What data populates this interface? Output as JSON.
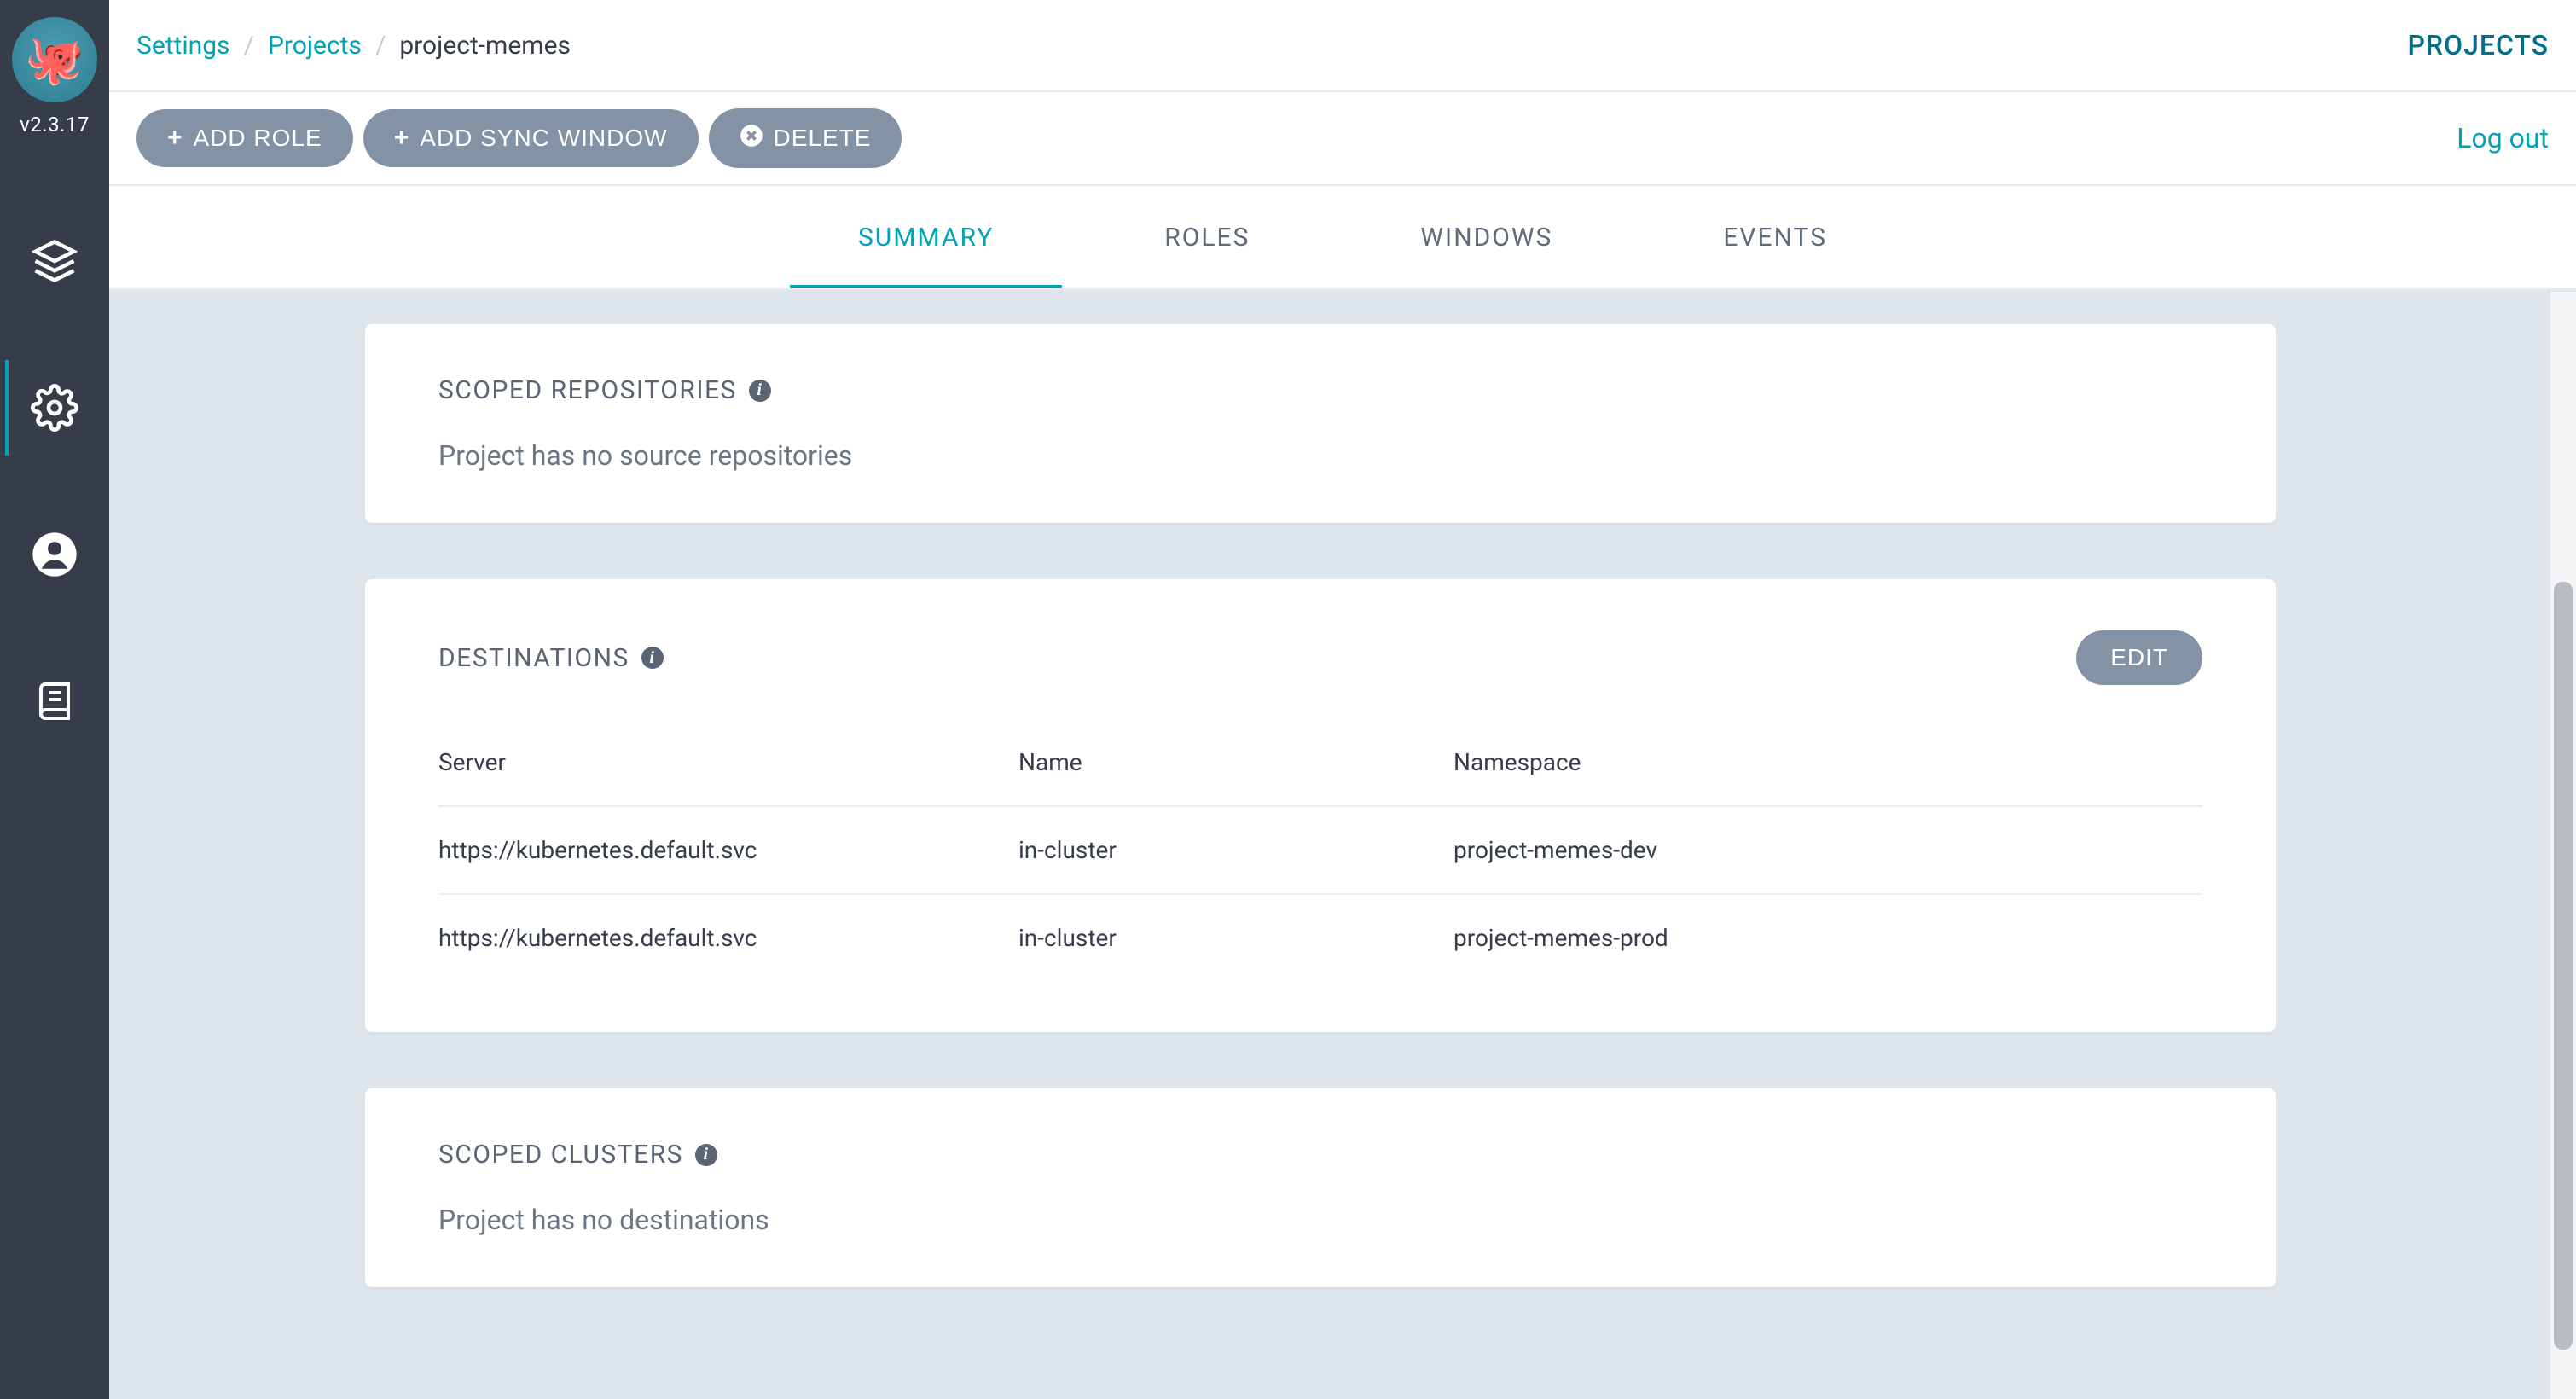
{
  "sidebar": {
    "version": "v2.3.17"
  },
  "breadcrumbs": {
    "settings": "Settings",
    "projects": "Projects",
    "current": "project-memes"
  },
  "page_title": "PROJECTS",
  "toolbar": {
    "add_role": "ADD ROLE",
    "add_sync_window": "ADD SYNC WINDOW",
    "delete": "DELETE",
    "logout": "Log out"
  },
  "tabs": [
    {
      "id": "summary",
      "label": "SUMMARY",
      "active": true
    },
    {
      "id": "roles",
      "label": "ROLES",
      "active": false
    },
    {
      "id": "windows",
      "label": "WINDOWS",
      "active": false
    },
    {
      "id": "events",
      "label": "EVENTS",
      "active": false
    }
  ],
  "cards": {
    "scoped_repos": {
      "title": "SCOPED REPOSITORIES",
      "empty": "Project has no source repositories"
    },
    "destinations": {
      "title": "DESTINATIONS",
      "edit": "EDIT",
      "columns": {
        "server": "Server",
        "name": "Name",
        "namespace": "Namespace"
      },
      "rows": [
        {
          "server": "https://kubernetes.default.svc",
          "name": "in-cluster",
          "namespace": "project-memes-dev"
        },
        {
          "server": "https://kubernetes.default.svc",
          "name": "in-cluster",
          "namespace": "project-memes-prod"
        }
      ]
    },
    "scoped_clusters": {
      "title": "SCOPED CLUSTERS",
      "empty": "Project has no destinations"
    }
  }
}
